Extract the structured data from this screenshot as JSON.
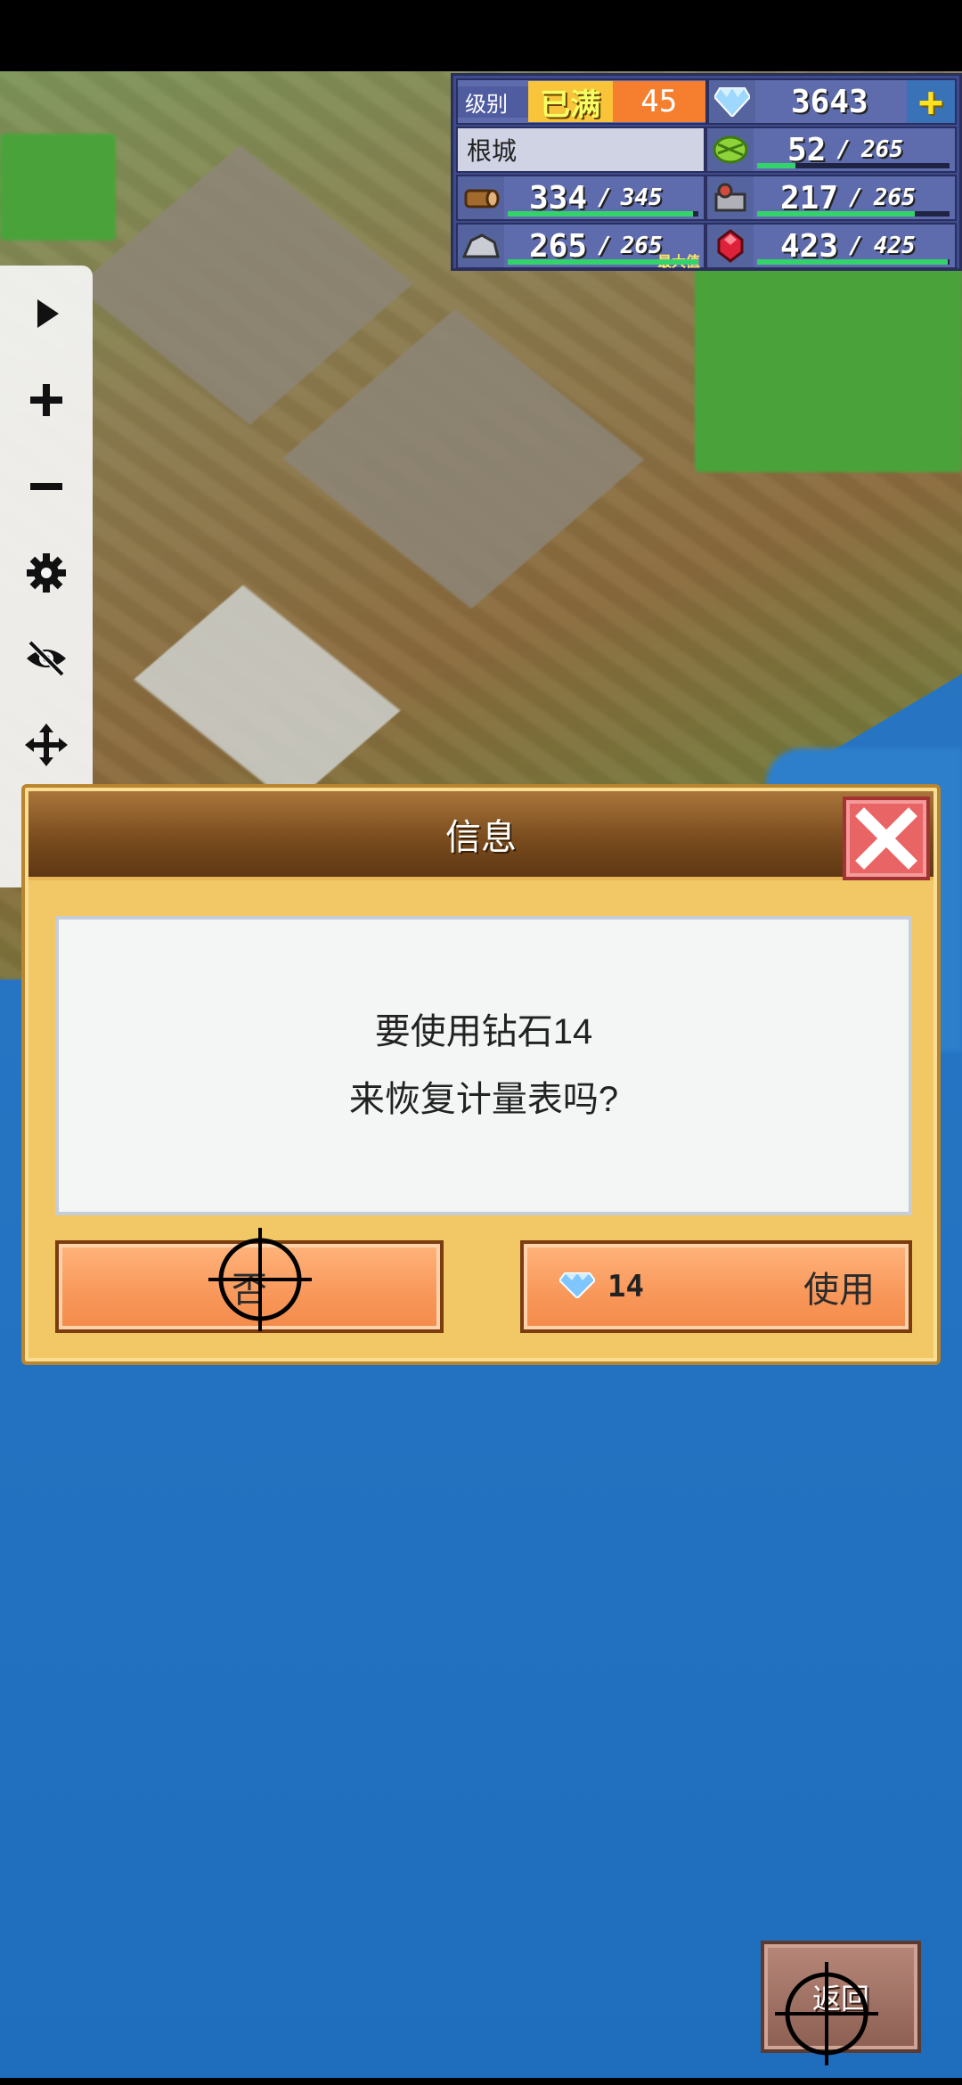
{
  "hud": {
    "level_label": "级别",
    "level_status": "已满",
    "level_value": "45",
    "diamonds": "3643",
    "town_name": "根城",
    "food": {
      "value": "52",
      "max": "265",
      "fill": 0.2
    },
    "wood": {
      "value": "334",
      "max": "345",
      "fill": 0.97
    },
    "tools": {
      "value": "217",
      "max": "265",
      "fill": 0.82
    },
    "ore": {
      "value": "265",
      "max": "265",
      "fill": 1.0,
      "max_tag": "最大值"
    },
    "ruby": {
      "value": "423",
      "max": "425",
      "fill": 0.99
    },
    "separator": "/"
  },
  "toolbar": {
    "icons": [
      "play-icon",
      "plus-icon",
      "minus-icon",
      "gear-icon",
      "eye-off-icon",
      "move-icon",
      "close-icon"
    ]
  },
  "dialog": {
    "title": "信息",
    "message_line1": "要使用钻石14",
    "message_line2": "来恢复计量表吗?",
    "no_label": "否",
    "use_cost": "14",
    "use_label": "使用"
  },
  "back_label": "返回",
  "colors": {
    "hud_bg": "#3d4b8f",
    "dialog_bg": "#f2c866",
    "button_orange": "#f8975a",
    "close_red": "#e96464",
    "sea_blue": "#2676c4"
  }
}
